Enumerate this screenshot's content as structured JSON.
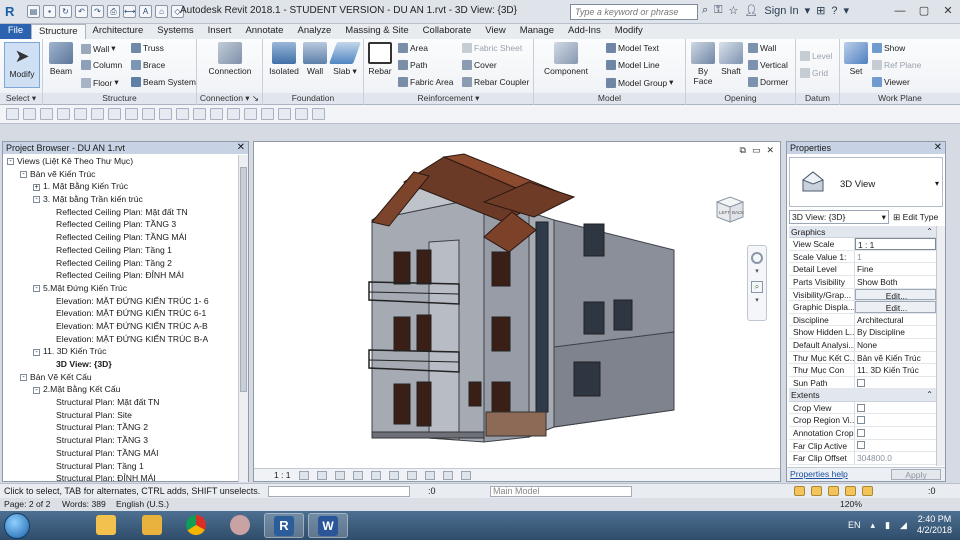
{
  "window": {
    "title": "Autodesk Revit 2018.1 - STUDENT VERSION -    DU AN 1.rvt - 3D View: {3D}",
    "search_placeholder": "Type a keyword or phrase",
    "sign_in": "Sign In"
  },
  "tabs": [
    "File",
    "Structure",
    "Architecture",
    "Systems",
    "Insert",
    "Annotate",
    "Analyze",
    "Massing & Site",
    "Collaborate",
    "View",
    "Manage",
    "Add-Ins",
    "Modify"
  ],
  "active_tab": "Structure",
  "ribbon": {
    "select": {
      "modify": "Modify",
      "label": "Select"
    },
    "structure": {
      "beam": "Beam",
      "wall": "Wall",
      "column": "Column",
      "floor": "Floor",
      "truss": "Truss",
      "brace": "Brace",
      "beam_system": "Beam  System",
      "label": "Structure"
    },
    "connection": {
      "connection": "Connection",
      "label": "Connection"
    },
    "foundation": {
      "isolated": "Isolated",
      "wall": "Wall",
      "slab": "Slab",
      "label": "Foundation"
    },
    "reinforcement": {
      "rebar": "Rebar",
      "area": "Area",
      "path": "Path",
      "fabric_area": "Fabric  Area",
      "fabric_sheet": "Fabric  Sheet",
      "cover": "Cover",
      "rebar_coupler": "Rebar  Coupler",
      "label": "Reinforcement"
    },
    "model": {
      "component": "Component",
      "model_text": "Model  Text",
      "model_line": "Model  Line",
      "model_group": "Model  Group",
      "label": "Model"
    },
    "opening": {
      "by_face": "By Face",
      "shaft": "Shaft",
      "wall": "Wall",
      "vertical": "Vertical",
      "dormer": "Dormer",
      "label": "Opening"
    },
    "datum": {
      "level": "Level",
      "grid": "Grid",
      "label": "Datum"
    },
    "work_plane": {
      "set": "Set",
      "show": "Show",
      "ref_plane": "Ref  Plane",
      "viewer": "Viewer",
      "label": "Work Plane"
    }
  },
  "project_browser": {
    "title": "Project Browser - DU AN 1.rvt",
    "items": [
      {
        "text": "Views (Liệt Kê Theo Thư Mục)",
        "level": 0,
        "toggle": "-",
        "bold": false
      },
      {
        "text": "Bản vẽ Kiến Trúc",
        "level": 1,
        "toggle": "-",
        "bold": false
      },
      {
        "text": "1. Mặt Bằng Kiến Trúc",
        "level": 2,
        "toggle": "+",
        "bold": false
      },
      {
        "text": "3. Mặt bằng Trần kiến trúc",
        "level": 2,
        "toggle": "-",
        "bold": false
      },
      {
        "text": "Reflected Ceiling Plan: Mặt đất TN",
        "level": 3,
        "toggle": "",
        "bold": false
      },
      {
        "text": "Reflected Ceiling Plan: TẦNG 3",
        "level": 3,
        "toggle": "",
        "bold": false
      },
      {
        "text": "Reflected Ceiling Plan: TẦNG MÁI",
        "level": 3,
        "toggle": "",
        "bold": false
      },
      {
        "text": "Reflected Ceiling Plan: Tầng 1",
        "level": 3,
        "toggle": "",
        "bold": false
      },
      {
        "text": "Reflected Ceiling Plan: Tầng 2",
        "level": 3,
        "toggle": "",
        "bold": false
      },
      {
        "text": "Reflected Ceiling Plan: ĐỈNH MÁI",
        "level": 3,
        "toggle": "",
        "bold": false
      },
      {
        "text": "5.Mặt Đứng Kiến Trúc",
        "level": 2,
        "toggle": "-",
        "bold": false
      },
      {
        "text": "Elevation: MẶT ĐỨNG KIẾN TRÚC 1- 6",
        "level": 3,
        "toggle": "",
        "bold": false
      },
      {
        "text": "Elevation: MẶT ĐỨNG KIẾN TRÚC 6-1",
        "level": 3,
        "toggle": "",
        "bold": false
      },
      {
        "text": "Elevation: MẶT ĐỨNG KIẾN TRÚC A-B",
        "level": 3,
        "toggle": "",
        "bold": false
      },
      {
        "text": "Elevation: MẶT ĐỨNG KIẾN TRÚC B-A",
        "level": 3,
        "toggle": "",
        "bold": false
      },
      {
        "text": "11. 3D Kiến Trúc",
        "level": 2,
        "toggle": "-",
        "bold": false
      },
      {
        "text": "3D View: {3D}",
        "level": 3,
        "toggle": "",
        "bold": true
      },
      {
        "text": "Bản Vẽ Kết Cấu",
        "level": 1,
        "toggle": "-",
        "bold": false
      },
      {
        "text": "2.Mặt Bằng Kết Cấu",
        "level": 2,
        "toggle": "-",
        "bold": false
      },
      {
        "text": "Structural Plan: Mặt đất TN",
        "level": 3,
        "toggle": "",
        "bold": false
      },
      {
        "text": "Structural Plan: Site",
        "level": 3,
        "toggle": "",
        "bold": false
      },
      {
        "text": "Structural Plan: TẦNG 2",
        "level": 3,
        "toggle": "",
        "bold": false
      },
      {
        "text": "Structural Plan: TẦNG 3",
        "level": 3,
        "toggle": "",
        "bold": false
      },
      {
        "text": "Structural Plan: TẦNG MÁI",
        "level": 3,
        "toggle": "",
        "bold": false
      },
      {
        "text": "Structural Plan: Tầng 1",
        "level": 3,
        "toggle": "",
        "bold": false
      },
      {
        "text": "Structural Plan: ĐỈNH MÁI",
        "level": 3,
        "toggle": "",
        "bold": false
      }
    ]
  },
  "canvas": {
    "scale": "1 : 1",
    "viewcube_left": "LEFT",
    "viewcube_back": "BACK"
  },
  "properties": {
    "title": "Properties",
    "type_name": "3D View",
    "view_selector": "3D View: {3D}",
    "edit_type": "Edit Type",
    "sections": [
      {
        "name": "Graphics",
        "rows": [
          {
            "label": "View Scale",
            "value": "1 : 1",
            "style": "box"
          },
          {
            "label": "Scale Value   1:",
            "value": "1",
            "style": "dim"
          },
          {
            "label": "Detail Level",
            "value": "Fine",
            "style": ""
          },
          {
            "label": "Parts Visibility",
            "value": "Show Both",
            "style": ""
          },
          {
            "label": "Visibility/Grap...",
            "value": "Edit...",
            "style": "btn"
          },
          {
            "label": "Graphic Displa...",
            "value": "Edit...",
            "style": "btn"
          },
          {
            "label": "Discipline",
            "value": "Architectural",
            "style": ""
          },
          {
            "label": "Show Hidden L...",
            "value": "By Discipline",
            "style": ""
          },
          {
            "label": "Default Analysi...",
            "value": "None",
            "style": ""
          },
          {
            "label": "Thư Mục Kết C...",
            "value": "Bản vẽ Kiến Trúc",
            "style": ""
          },
          {
            "label": "Thư Mục Con",
            "value": "11. 3D Kiến Trúc",
            "style": ""
          },
          {
            "label": "Sun Path",
            "value": "",
            "style": "check"
          }
        ]
      },
      {
        "name": "Extents",
        "rows": [
          {
            "label": "Crop View",
            "value": "",
            "style": "check"
          },
          {
            "label": "Crop Region Vi...",
            "value": "",
            "style": "check"
          },
          {
            "label": "Annotation Crop",
            "value": "",
            "style": "check"
          },
          {
            "label": "Far Clip Active",
            "value": "",
            "style": "check"
          },
          {
            "label": "Far Clip Offset",
            "value": "304800.0",
            "style": "dim"
          }
        ]
      }
    ],
    "help_link": "Properties help",
    "apply": "Apply"
  },
  "status": {
    "message": "Click to select, TAB for alternates, CTRL adds, SHIFT unselects.",
    "zero": ":0",
    "model": "Main Model",
    "filter": ":0"
  },
  "word_status": {
    "page": "Page: 2 of 2",
    "words": "Words: 389",
    "lang": "English (U.S.)",
    "zoom": "120%"
  },
  "taskbar": {
    "lang": "EN",
    "time": "2:40 PM",
    "date": "4/2/2018"
  }
}
